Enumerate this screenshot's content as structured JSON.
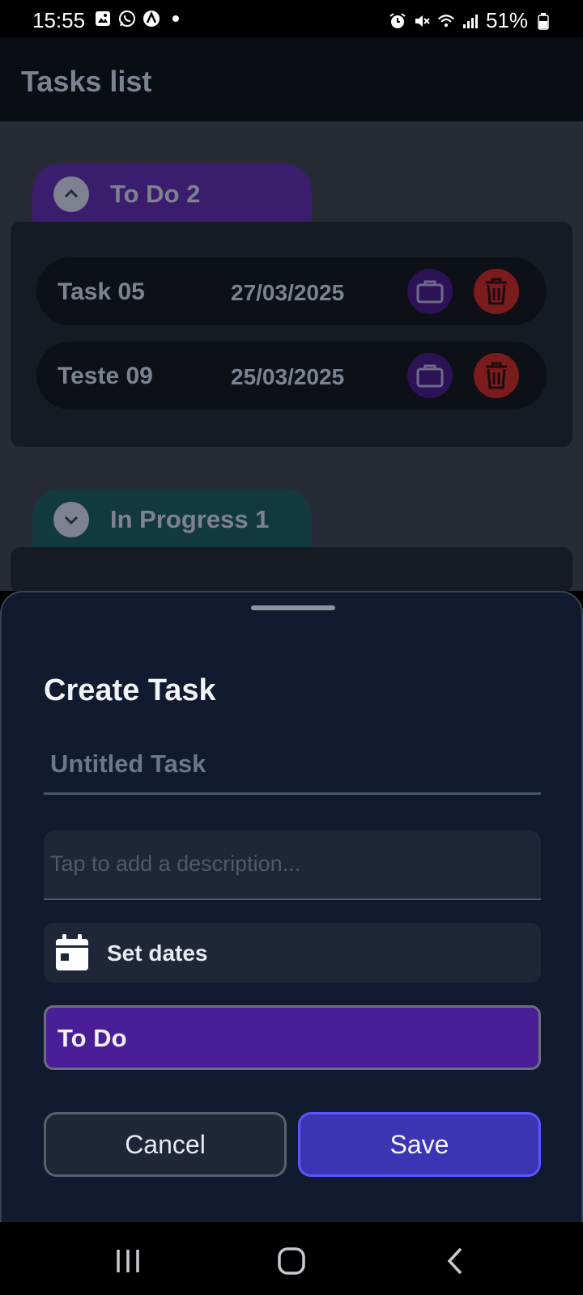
{
  "status_bar": {
    "time": "15:55",
    "left_icons": [
      "gallery-icon",
      "whatsapp-icon",
      "app-icon",
      "dot-icon"
    ],
    "right_icons": [
      "alarm-icon",
      "mute-icon",
      "wifi-icon",
      "signal-icon"
    ],
    "battery": "51%"
  },
  "app_bar": {
    "title": "Tasks list"
  },
  "groups": [
    {
      "label": "To Do 2",
      "color": "#3a1d6c",
      "expanded": true,
      "tasks": [
        {
          "name": "Task 05",
          "date": "27/03/2025"
        },
        {
          "name": "Teste 09",
          "date": "25/03/2025"
        }
      ]
    },
    {
      "label": "In Progress 1",
      "color": "#12393f",
      "expanded": false,
      "tasks": []
    }
  ],
  "sheet": {
    "title": "Create Task",
    "title_placeholder": "Untitled Task",
    "description_placeholder": "Tap to add a description...",
    "dates_label": "Set dates",
    "status_value": "To Do",
    "cancel_label": "Cancel",
    "save_label": "Save"
  },
  "colors": {
    "accent": "#3b35b4",
    "status_todo": "#4a1e96",
    "delete": "#7a1b1c"
  }
}
